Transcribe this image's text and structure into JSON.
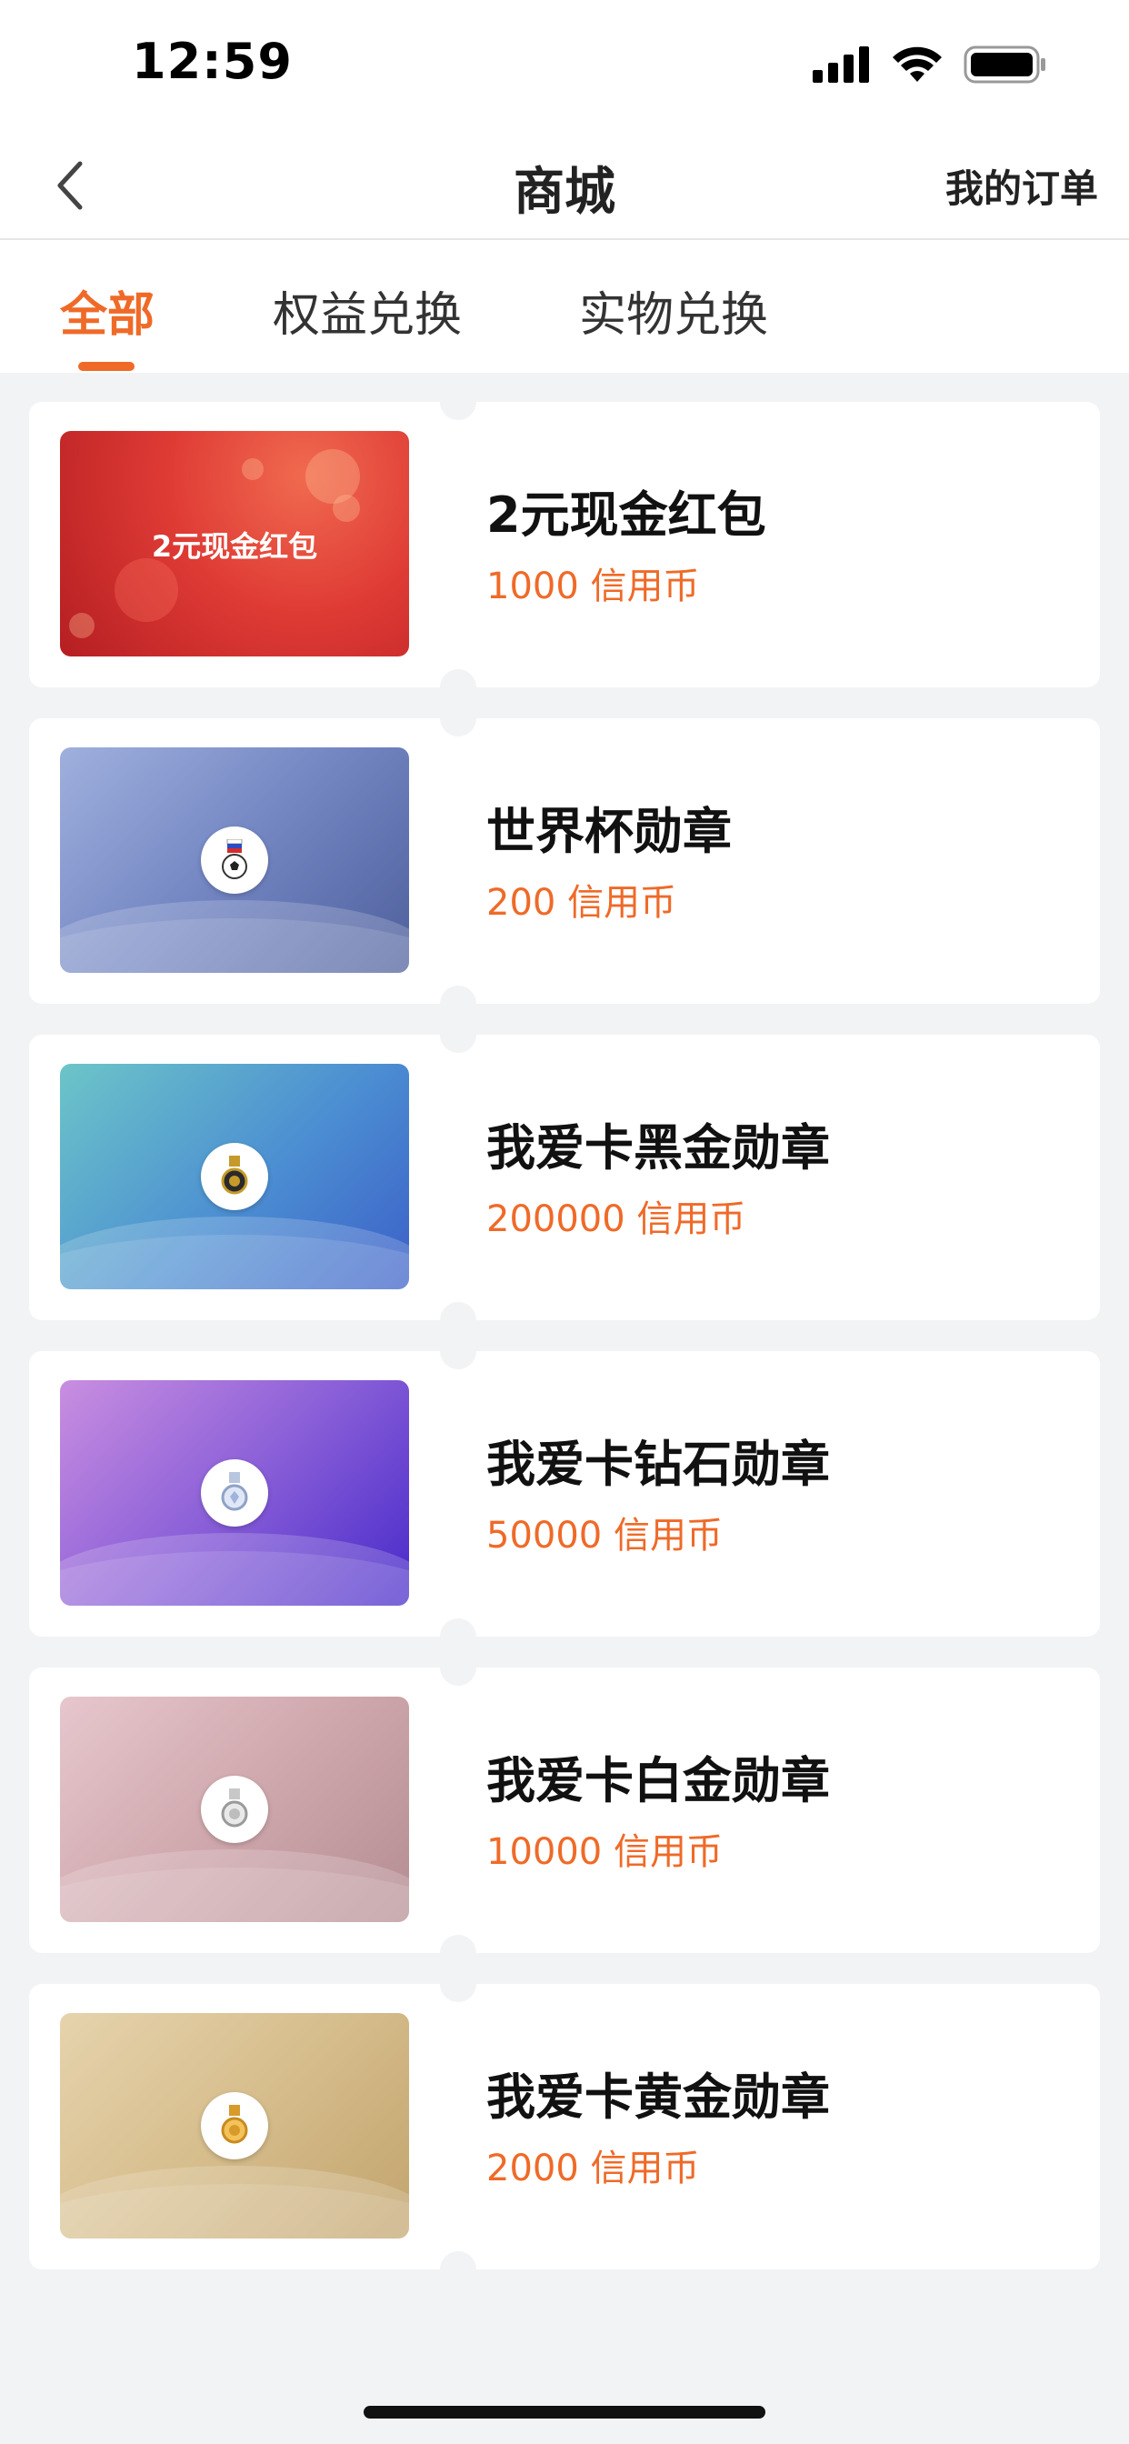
{
  "status_bar": {
    "time": "12:59"
  },
  "nav": {
    "title": "商城",
    "orders_link": "我的订单"
  },
  "tabs": [
    {
      "label": "全部",
      "active": true
    },
    {
      "label": "权益兑换",
      "active": false
    },
    {
      "label": "实物兑换",
      "active": false
    }
  ],
  "accent_color": "#ef6a28",
  "items": [
    {
      "title": "2元现金红包",
      "price": "1000 信用币",
      "thumb_text": "2元现金红包",
      "icon": "red-envelope"
    },
    {
      "title": "世界杯勋章",
      "price": "200 信用币",
      "icon": "football-medal-icon"
    },
    {
      "title": "我爱卡黑金勋章",
      "price": "200000 信用币",
      "icon": "black-gold-medal-icon"
    },
    {
      "title": "我爱卡钻石勋章",
      "price": "50000 信用币",
      "icon": "diamond-medal-icon"
    },
    {
      "title": "我爱卡白金勋章",
      "price": "10000 信用币",
      "icon": "platinum-medal-icon"
    },
    {
      "title": "我爱卡黄金勋章",
      "price": "2000 信用币",
      "icon": "gold-medal-icon"
    }
  ]
}
